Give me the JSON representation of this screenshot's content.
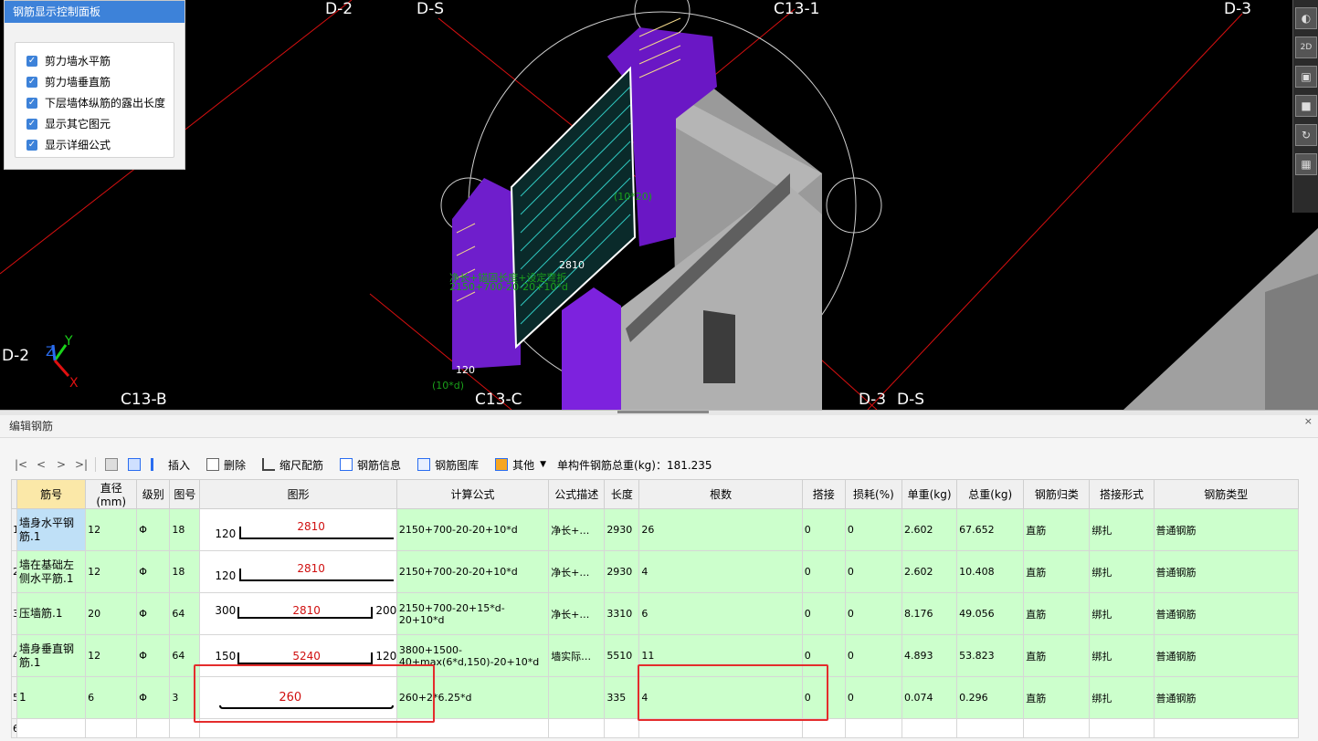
{
  "viewport": {
    "axis_labels": {
      "d2_top": "D-2",
      "ds_top": "D-S",
      "c13_1": "C13-1",
      "d3_top": "D-3",
      "d2_left": "D-2",
      "c13_b": "C13-B",
      "c13_c": "C13-C",
      "d3_bottom": "D-3",
      "ds_bottom": "D-S"
    },
    "dimension_labels": {
      "top_2810": "2810",
      "side_120": "120",
      "bracket_10d": "(10*d)",
      "bracket_top": "(10*20)"
    },
    "green_notes": {
      "line1": "净长+锚固长度+设定弯折",
      "line2": "2150+700-20-20+10*d"
    },
    "axes_gizmo": {
      "y": "Y",
      "z": "Z",
      "x": "X"
    },
    "colors": {
      "background": "#000000",
      "wall": "#a9a9a9",
      "rebar_purple": "#7b22d6",
      "axis_line": "#e01010"
    }
  },
  "control_panel": {
    "title": "钢筋显示控制面板",
    "options": [
      {
        "label": "剪力墙水平筋",
        "checked": true
      },
      {
        "label": "剪力墙垂直筋",
        "checked": true
      },
      {
        "label": "下层墙体纵筋的露出长度",
        "checked": true
      },
      {
        "label": "显示其它图元",
        "checked": true
      },
      {
        "label": "显示详细公式",
        "checked": true
      }
    ]
  },
  "right_toolbar": {
    "icons": [
      "orbit-icon",
      "2d-view-icon",
      "3d-box-icon",
      "front-view-icon",
      "rotate-icon",
      "grid-view-icon"
    ],
    "label_2d": "2D"
  },
  "editor": {
    "title": "编辑钢筋",
    "close_glyph": "×",
    "toolbar": {
      "nav_first": "|<",
      "nav_prev": "<",
      "nav_next": ">",
      "nav_last": ">|",
      "insert": "插入",
      "delete": "删除",
      "scale_rebar": "缩尺配筋",
      "rebar_info": "钢筋信息",
      "rebar_library": "钢筋图库",
      "other": "其他",
      "total_weight_label": "单构件钢筋总重(kg)：181.235"
    },
    "columns": [
      "筋号",
      "直径(mm)",
      "级别",
      "图号",
      "图形",
      "计算公式",
      "公式描述",
      "长度",
      "根数",
      "搭接",
      "损耗(%)",
      "单重(kg)",
      "总重(kg)",
      "钢筋归类",
      "搭接形式",
      "钢筋类型"
    ],
    "rows": [
      {
        "row_no": "1",
        "name": "墙身水平钢筋.1",
        "diameter": "12",
        "grade": "Φ",
        "shape_no": "18",
        "shape": {
          "left": "120",
          "middle": "2810",
          "right": ""
        },
        "formula": "2150+700-20-20+10*d",
        "desc": "净长+…",
        "length": "2930",
        "count": "26",
        "lap": "0",
        "loss": "0",
        "unit_weight": "2.602",
        "total_weight": "67.652",
        "category": "直筋",
        "lap_type": "绑扎",
        "rebar_type": "普通钢筋"
      },
      {
        "row_no": "2",
        "name": "墙在基础左侧水平筋.1",
        "diameter": "12",
        "grade": "Φ",
        "shape_no": "18",
        "shape": {
          "left": "120",
          "middle": "2810",
          "right": ""
        },
        "formula": "2150+700-20-20+10*d",
        "desc": "净长+…",
        "length": "2930",
        "count": "4",
        "lap": "0",
        "loss": "0",
        "unit_weight": "2.602",
        "total_weight": "10.408",
        "category": "直筋",
        "lap_type": "绑扎",
        "rebar_type": "普通钢筋"
      },
      {
        "row_no": "3",
        "name": "压墙筋.1",
        "diameter": "20",
        "grade": "Φ",
        "shape_no": "64",
        "shape": {
          "left": "300",
          "middle": "2810",
          "right": "200"
        },
        "formula": "2150+700-20+15*d-20+10*d",
        "desc": "净长+…",
        "length": "3310",
        "count": "6",
        "lap": "0",
        "loss": "0",
        "unit_weight": "8.176",
        "total_weight": "49.056",
        "category": "直筋",
        "lap_type": "绑扎",
        "rebar_type": "普通钢筋"
      },
      {
        "row_no": "4",
        "name": "墙身垂直钢筋.1",
        "diameter": "12",
        "grade": "Φ",
        "shape_no": "64",
        "shape": {
          "left": "150",
          "middle": "5240",
          "right": "120"
        },
        "formula": "3800+1500-40+max(6*d,150)-20+10*d",
        "desc": "墙实际…",
        "length": "5510",
        "count": "11",
        "lap": "0",
        "loss": "0",
        "unit_weight": "4.893",
        "total_weight": "53.823",
        "category": "直筋",
        "lap_type": "绑扎",
        "rebar_type": "普通钢筋"
      },
      {
        "row_no": "5",
        "name": "1",
        "diameter": "6",
        "grade": "Φ",
        "shape_no": "3",
        "shape": {
          "left": "",
          "middle": "260",
          "right": ""
        },
        "formula": "260+2*6.25*d",
        "desc": "",
        "length": "335",
        "count": "4",
        "lap": "0",
        "loss": "0",
        "unit_weight": "0.074",
        "total_weight": "0.296",
        "category": "直筋",
        "lap_type": "绑扎",
        "rebar_type": "普通钢筋"
      },
      {
        "row_no": "6"
      }
    ],
    "highlight_color": "#ccffcc",
    "annotation_color": "#e42c2c"
  }
}
